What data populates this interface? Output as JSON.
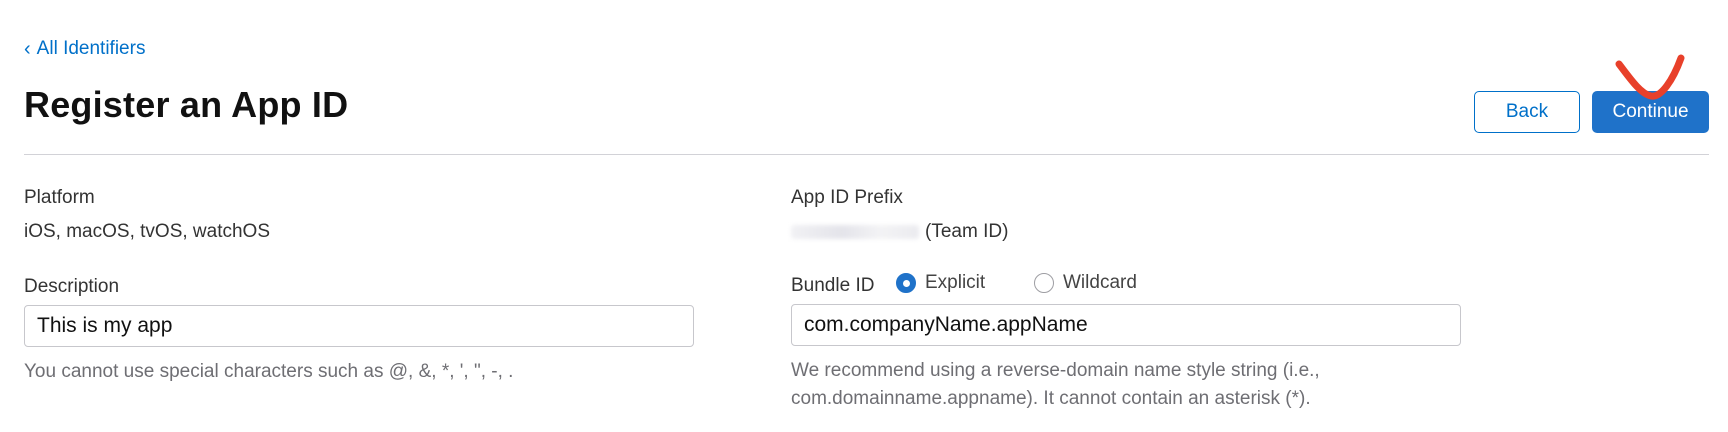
{
  "nav": {
    "back_link_label": "All Identifiers"
  },
  "header": {
    "title": "Register an App ID",
    "back_button": "Back",
    "continue_button": "Continue"
  },
  "platform": {
    "label": "Platform",
    "value": "iOS, macOS, tvOS, watchOS"
  },
  "prefix": {
    "label": "App ID Prefix",
    "suffix": "(Team ID)"
  },
  "description": {
    "label": "Description",
    "value": "This is my app",
    "help": "You cannot use special characters such as @, &, *, ', \", -, ."
  },
  "bundle": {
    "label": "Bundle ID",
    "options": [
      {
        "label": "Explicit",
        "checked": true
      },
      {
        "label": "Wildcard",
        "checked": false
      }
    ],
    "value": "com.companyName.appName",
    "help_line1": "We recommend using a reverse-domain name style string (i.e.,",
    "help_line2": "com.domainname.appname). It cannot contain an asterisk (*)."
  },
  "colors": {
    "accent": "#1f72c9",
    "link": "#0070c9",
    "annotation": "#e8402a"
  }
}
